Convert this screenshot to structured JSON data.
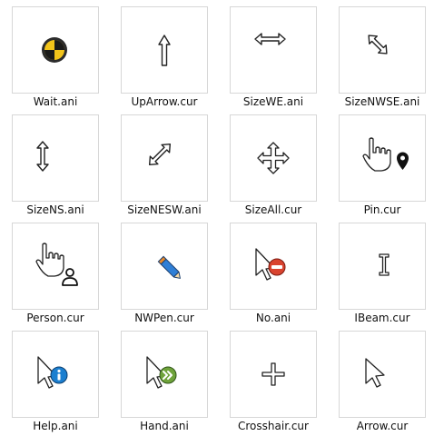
{
  "files": [
    {
      "name": "Wait.ani",
      "icon": "wait-icon"
    },
    {
      "name": "UpArrow.cur",
      "icon": "up-arrow-icon"
    },
    {
      "name": "SizeWE.ani",
      "icon": "size-we-icon"
    },
    {
      "name": "SizeNWSE.ani",
      "icon": "size-nwse-icon"
    },
    {
      "name": "SizeNS.ani",
      "icon": "size-ns-icon"
    },
    {
      "name": "SizeNESW.ani",
      "icon": "size-nesw-icon"
    },
    {
      "name": "SizeAll.cur",
      "icon": "size-all-icon"
    },
    {
      "name": "Pin.cur",
      "icon": "pin-hand-icon"
    },
    {
      "name": "Person.cur",
      "icon": "person-hand-icon"
    },
    {
      "name": "NWPen.cur",
      "icon": "pen-icon"
    },
    {
      "name": "No.ani",
      "icon": "no-icon"
    },
    {
      "name": "IBeam.cur",
      "icon": "ibeam-icon"
    },
    {
      "name": "Help.ani",
      "icon": "help-arrow-icon"
    },
    {
      "name": "Hand.ani",
      "icon": "hand-arrow-icon"
    },
    {
      "name": "Crosshair.cur",
      "icon": "crosshair-icon"
    },
    {
      "name": "Arrow.cur",
      "icon": "arrow-icon"
    }
  ],
  "colors": {
    "wait_yellow": "#f2c41a",
    "pen_blue": "#2f7fd6",
    "pen_orange": "#e88a2c",
    "no_red": "#d9432f",
    "help_blue": "#1b7fd0",
    "hand_green": "#6fa33b",
    "border": "#d7d7d7"
  }
}
